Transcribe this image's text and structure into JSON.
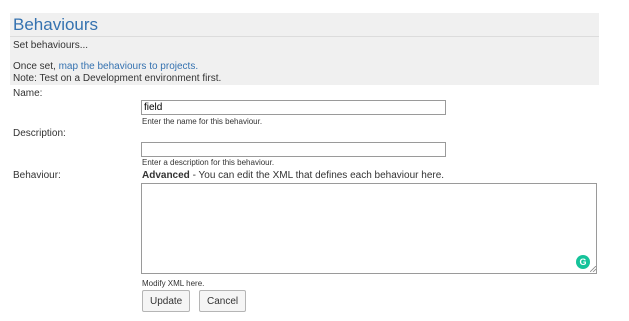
{
  "header": {
    "title": "Behaviours",
    "subtitle": "Set behaviours...",
    "desc_prefix": "Once set, ",
    "desc_link": "map the behaviours to projects.",
    "note": "Note: Test on a Development environment first."
  },
  "form": {
    "name_label": "Name:",
    "name_value": "field",
    "name_hint": "Enter the name for this behaviour.",
    "description_label": "Description:",
    "description_value": "",
    "description_hint": "Enter a description for this behaviour.",
    "behaviour_label": "Behaviour:",
    "advanced_bold": "Advanced",
    "advanced_text": " - You can edit the XML that defines each behaviour here.",
    "xml_value": "",
    "xml_hint": "Modify XML here."
  },
  "actions": {
    "update_label": "Update",
    "cancel_label": "Cancel"
  },
  "icons": {
    "grammarly": "grammarly-icon",
    "grammarly_letter": "G",
    "grip": "resize-grip-icon"
  },
  "colors": {
    "link": "#3572b0",
    "panel": "#f0f0f0",
    "grammarly": "#15c39a"
  }
}
